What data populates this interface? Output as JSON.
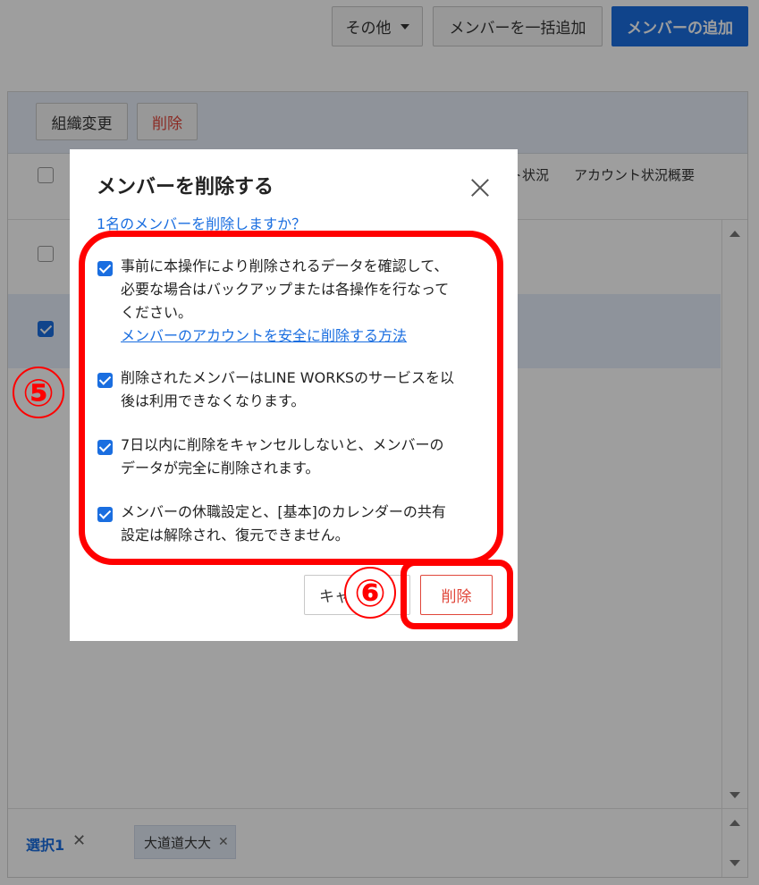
{
  "topbar": {
    "other_label": "その他",
    "bulk_add_label": "メンバーを一括追加",
    "add_member_label": "メンバーの追加"
  },
  "toolbar": {
    "org_change_label": "組織変更",
    "delete_label": "削除"
  },
  "table": {
    "header_partial": "ト状況",
    "header_summary": "アカウント状況概要"
  },
  "footer": {
    "selected_label": "選択1",
    "chip_label": "大道道大大"
  },
  "dialog": {
    "title": "メンバーを削除する",
    "question": "1名のメンバーを削除しますか？",
    "items": [
      {
        "line1": "事前に本操作により削除されるデータを確認して、",
        "line2": "必要な場合はバックアップまたは各操作を行なって",
        "line3": "ください。",
        "link": "メンバーのアカウントを安全に削除する方法"
      },
      {
        "line1": "削除されたメンバーはLINE WORKSのサービスを以",
        "line2": "後は利用できなくなります。"
      },
      {
        "line1": "7日以内に削除をキャンセルしないと、メンバーの",
        "line2": "データが完全に削除されます。"
      },
      {
        "line1": "メンバーの休職設定と、[基本]のカレンダーの共有",
        "line2": "設定は解除され、復元できません。"
      }
    ],
    "cancel_label": "キャンセル",
    "delete_label": "削除"
  },
  "annotations": {
    "step5": "⑤",
    "step6": "⑥"
  },
  "colors": {
    "primary": "#1a6ee0",
    "danger": "#e0463a",
    "annotation": "#ff0000"
  }
}
